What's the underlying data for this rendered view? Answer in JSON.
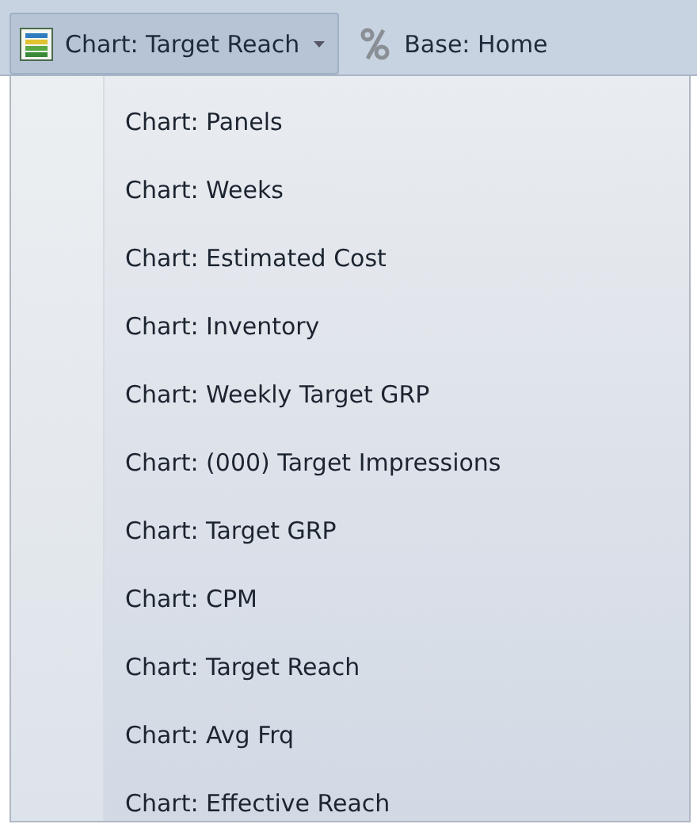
{
  "toolbar": {
    "buttons": [
      {
        "label": "Chart: Target Reach",
        "kind": "chart",
        "pressed": true,
        "dropdown": true
      },
      {
        "label": "Base: Home",
        "kind": "percent",
        "pressed": false,
        "dropdown": false
      }
    ]
  },
  "menu": {
    "items": [
      {
        "label": "Chart: Panels"
      },
      {
        "label": "Chart: Weeks"
      },
      {
        "label": "Chart: Estimated Cost"
      },
      {
        "label": "Chart: Inventory"
      },
      {
        "label": "Chart: Weekly Target GRP"
      },
      {
        "label": "Chart: (000) Target Impressions"
      },
      {
        "label": "Chart: Target GRP"
      },
      {
        "label": "Chart: CPM"
      },
      {
        "label": "Chart: Target Reach"
      },
      {
        "label": "Chart: Avg Frq"
      },
      {
        "label": "Chart: Effective Reach"
      }
    ]
  }
}
